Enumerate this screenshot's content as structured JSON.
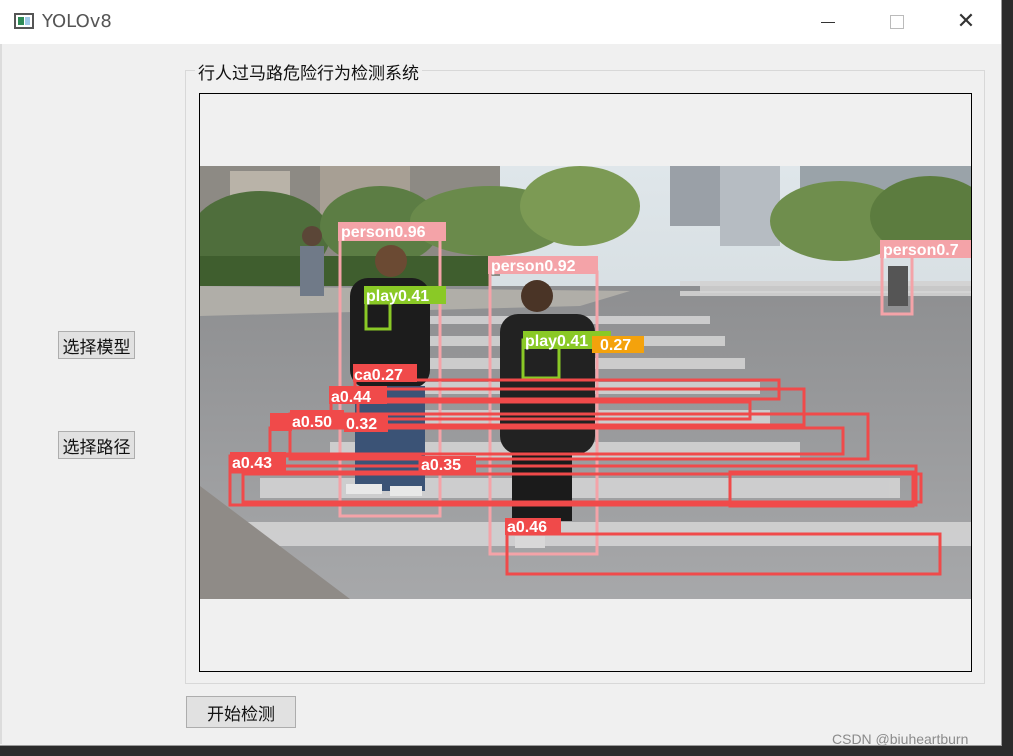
{
  "window": {
    "title": "YOLOv8"
  },
  "groupbox": {
    "title": "行人过马路危险行为检测系统"
  },
  "buttons": {
    "select_model": "选择模型",
    "select_path": "选择路径",
    "start_detect": "开始检测"
  },
  "detections": [
    {
      "label": "person0.96"
    },
    {
      "label": "person0.92"
    },
    {
      "label": "person0.7"
    },
    {
      "label": "play0.41"
    },
    {
      "label": "play0.41"
    },
    {
      "label": "0.27"
    },
    {
      "label": "ca0.27"
    },
    {
      "label": "a0.44"
    },
    {
      "label": "a0.50"
    },
    {
      "label": "0.32"
    },
    {
      "label": "a0.43"
    },
    {
      "label": "a0.35"
    },
    {
      "label": "a0.46"
    }
  ],
  "watermark": "CSDN @biuheartburn",
  "colors": {
    "person_box": "#f4a3a8",
    "phone_box": "#8ac926",
    "crosswalk_box": "#f04a4a",
    "orange_label": "#f4a20c"
  }
}
